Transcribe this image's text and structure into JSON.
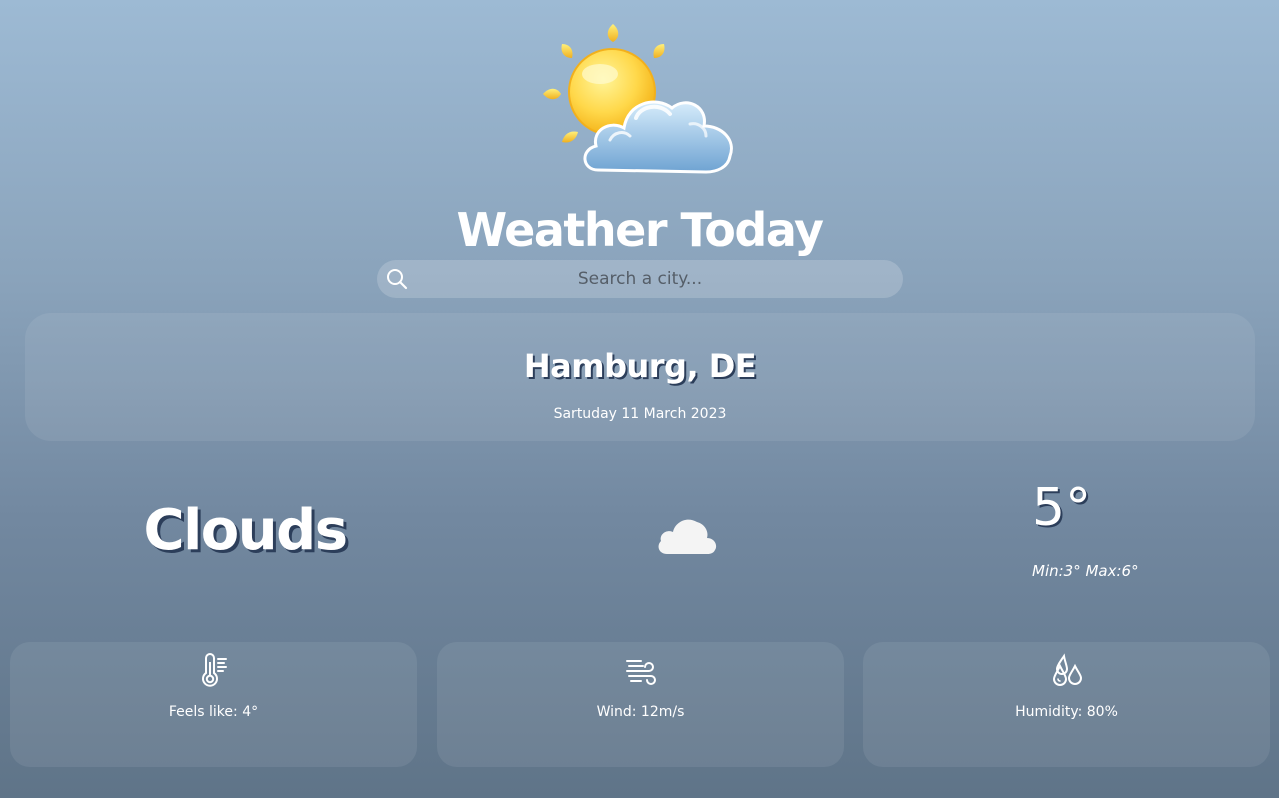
{
  "header": {
    "title": "Weather Today",
    "logo_icon": "sun-behind-cloud-icon"
  },
  "search": {
    "placeholder": "Search a city...",
    "value": "",
    "icon": "search-icon"
  },
  "location": {
    "city": "Hamburg, DE",
    "date": "Sartuday 11 March 2023"
  },
  "current": {
    "condition": "Clouds",
    "condition_icon": "cloud-icon",
    "temperature": "5°",
    "min_max": "Min:3° Max:6°"
  },
  "stats": [
    {
      "icon": "thermometer-icon",
      "label": "Feels like: 4°"
    },
    {
      "icon": "wind-icon",
      "label": "Wind: 12m/s"
    },
    {
      "icon": "humidity-icon",
      "label": "Humidity: 80%"
    }
  ],
  "colors": {
    "background_top": "#9dbad4",
    "background_bottom": "#5f7488",
    "text": "#ffffff",
    "text_shadow": "#2c3e5a"
  }
}
